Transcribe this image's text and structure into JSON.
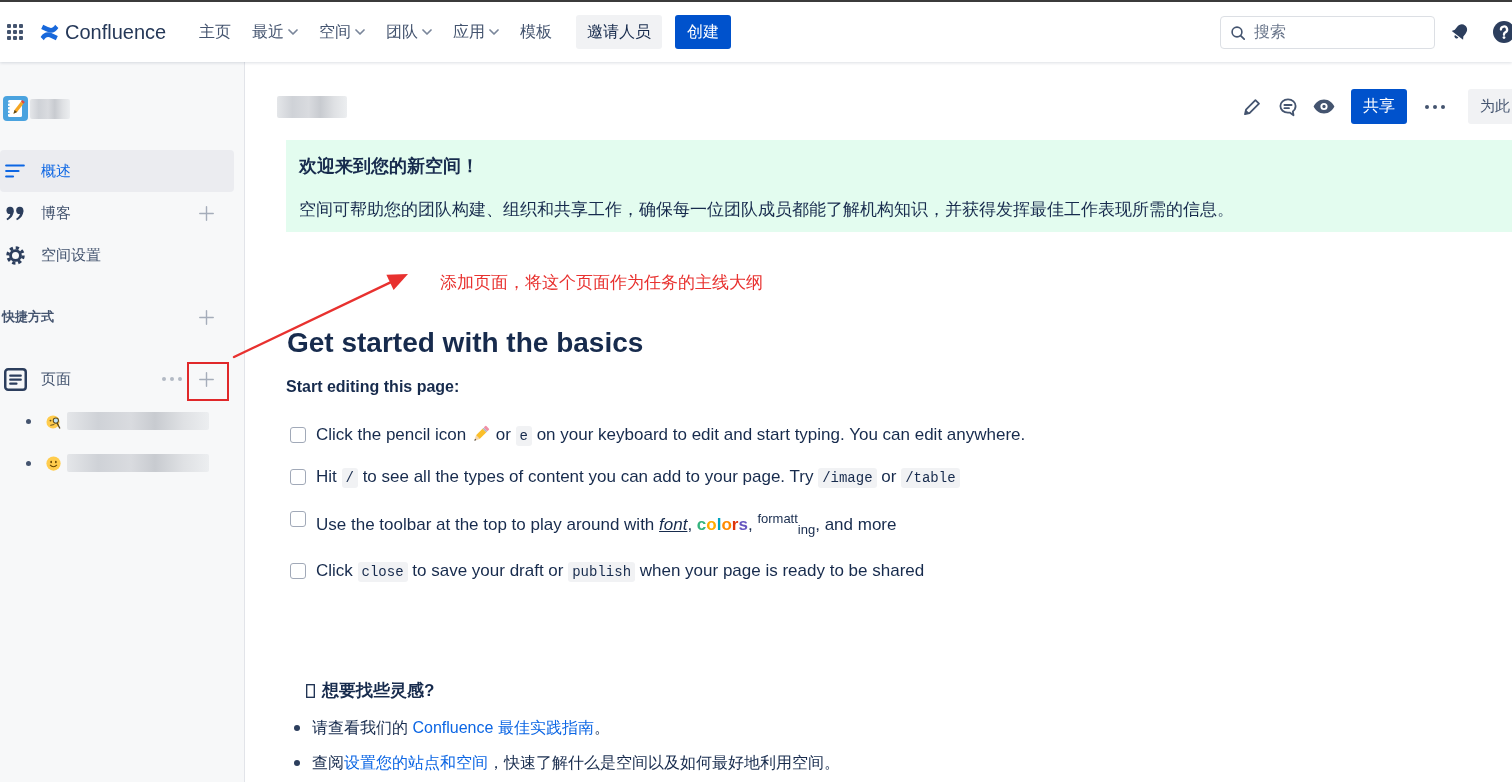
{
  "top_nav": {
    "brand": "Confluence",
    "menu": [
      {
        "label": "主页",
        "dropdown": false
      },
      {
        "label": "最近",
        "dropdown": true
      },
      {
        "label": "空间",
        "dropdown": true
      },
      {
        "label": "团队",
        "dropdown": true
      },
      {
        "label": "应用",
        "dropdown": true
      },
      {
        "label": "模板",
        "dropdown": false
      }
    ],
    "invite_button": "邀请人员",
    "create_button": "创建",
    "search": {
      "placeholder": "搜索"
    }
  },
  "sidebar": {
    "items": [
      {
        "label": "概述",
        "selected": true,
        "add_button": false
      },
      {
        "label": "博客",
        "selected": false,
        "add_button": true
      },
      {
        "label": "空间设置",
        "selected": false,
        "add_button": false
      }
    ],
    "shortcuts": {
      "label": "快捷方式"
    },
    "pages": {
      "label": "页面",
      "children": [
        {
          "kind": "redacted"
        },
        {
          "kind": "redacted"
        }
      ]
    }
  },
  "page": {
    "toolbar": {
      "share_button": "共享",
      "overflow_button": "为此"
    },
    "welcome": {
      "title": "欢迎来到您的新空间！",
      "text": "空间可帮助您的团队构建、组织和共享工作，确保每一位团队成员都能了解机构知识，并获得发挥最佳工作表现所需的信息。"
    },
    "annotation": {
      "text": "添加页面，将这个页面作为任务的主线大纲"
    },
    "heading": "Get started with the basics",
    "subheading": "Start editing this page:",
    "tasks": [
      {
        "checked": false,
        "parts": [
          {
            "kind": "text",
            "text": "Click the pencil icon "
          },
          {
            "kind": "emoji"
          },
          {
            "kind": "text",
            "text": " or "
          },
          {
            "kind": "code",
            "text": "e"
          },
          {
            "kind": "text",
            "text": " on your keyboard to edit and start typing. You can edit anywhere."
          }
        ]
      },
      {
        "checked": false,
        "parts": [
          {
            "kind": "text",
            "text": "Hit "
          },
          {
            "kind": "code",
            "text": "/"
          },
          {
            "kind": "text",
            "text": " to see all the types of content you can add to your page. Try "
          },
          {
            "kind": "code",
            "text": "/image"
          },
          {
            "kind": "text",
            "text": " or "
          },
          {
            "kind": "code",
            "text": "/table"
          }
        ]
      },
      {
        "checked": false,
        "parts": [
          {
            "kind": "text",
            "text": "Use the toolbar at the top to play around with "
          },
          {
            "kind": "italic",
            "text": "font"
          },
          {
            "kind": "text",
            "text": ", "
          },
          {
            "kind": "colored",
            "text": "c",
            "color": "#36b37e"
          },
          {
            "kind": "colored",
            "text": "o",
            "color": "#ffab00"
          },
          {
            "kind": "colored",
            "text": "l",
            "color": "#00a3bf"
          },
          {
            "kind": "colored",
            "text": "o",
            "color": "#ff8b00"
          },
          {
            "kind": "colored",
            "text": "r",
            "color": "#de350b"
          },
          {
            "kind": "colored",
            "text": "s",
            "color": "#6554c0"
          },
          {
            "kind": "text",
            "text": ", "
          },
          {
            "kind": "sup",
            "text": "formatt"
          },
          {
            "kind": "sub",
            "text": "ing"
          },
          {
            "kind": "text",
            "text": ", and more"
          }
        ]
      },
      {
        "checked": false,
        "parts": [
          {
            "kind": "text",
            "text": "Click "
          },
          {
            "kind": "code",
            "text": "close"
          },
          {
            "kind": "text",
            "text": " to save your draft or "
          },
          {
            "kind": "code",
            "text": "publish"
          },
          {
            "kind": "text",
            "text": " when your page is ready to be shared"
          }
        ]
      }
    ],
    "inspiration": {
      "title": "想要找些灵感?",
      "items": [
        {
          "parts": [
            {
              "kind": "text",
              "text": "请查看我们的 "
            },
            {
              "kind": "link",
              "text": "Confluence 最佳实践指南"
            },
            {
              "kind": "text",
              "text": "。"
            }
          ]
        },
        {
          "parts": [
            {
              "kind": "text",
              "text": "查阅"
            },
            {
              "kind": "link",
              "text": "设置您的站点和空间"
            },
            {
              "kind": "text",
              "text": "，快速了解什么是空间以及如何最好地利用空间。"
            }
          ]
        }
      ]
    }
  }
}
